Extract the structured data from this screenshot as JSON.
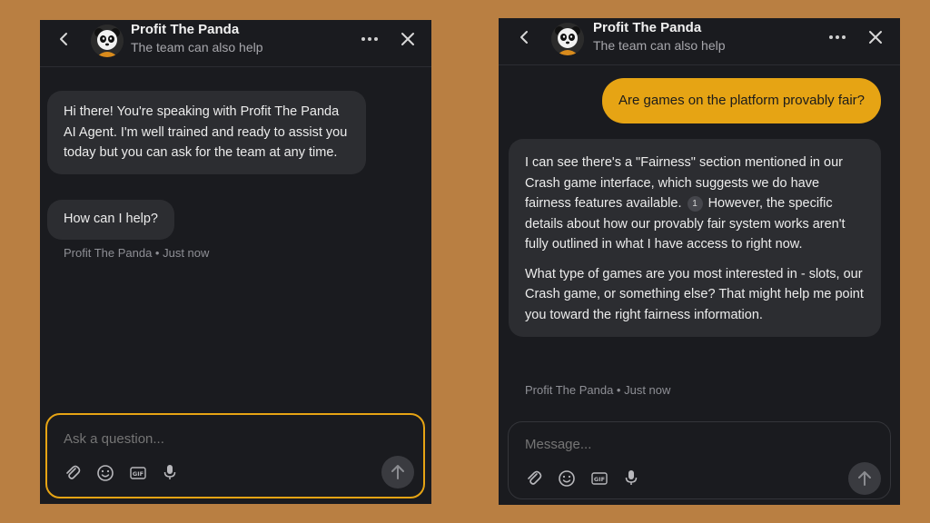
{
  "agent": {
    "name": "Profit The Panda",
    "status": "The team can also help"
  },
  "left": {
    "messages": [
      "Hi there! You're speaking with Profit The Panda AI Agent. I'm well trained and ready to assist you today but you can ask for the team at any time.",
      "How can I help?"
    ],
    "meta": "Profit The Panda • Just now",
    "composer_placeholder": "Ask a question..."
  },
  "right": {
    "user_message": "Are games on the platform provably fair?",
    "reply_part1": "I can see there's a \"Fairness\" section mentioned in our Crash game interface, which suggests we do have fairness features available.",
    "citation": "1",
    "reply_part2": "However, the specific details about how our provably fair system works aren't fully outlined in what I have access to right now.",
    "reply_para2": "What type of games are you most interested in - slots, our Crash game, or something else? That might help me point you toward the right fairness information.",
    "meta": "Profit The Panda • Just now",
    "composer_placeholder": "Message..."
  },
  "colors": {
    "background": "#b97f42",
    "panel": "#1a1b1f",
    "bubble": "#2c2d31",
    "user_bubble": "#e6a414",
    "focus_border": "#e6a414"
  },
  "icons": [
    "back-icon",
    "panda-avatar",
    "more-icon",
    "close-icon",
    "attach-icon",
    "emoji-icon",
    "gif-icon",
    "microphone-icon",
    "send-arrow-icon"
  ]
}
